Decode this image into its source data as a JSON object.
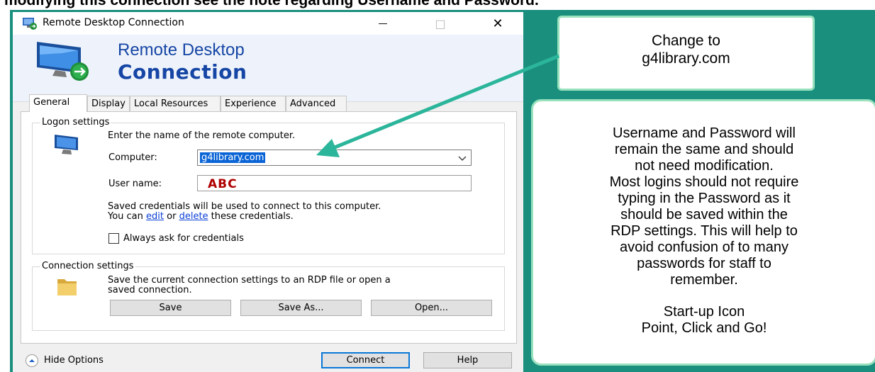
{
  "caption": "modifying this connection see the note regarding Username and Password.",
  "window": {
    "title": "Remote Desktop Connection",
    "minimize_glyph": "—",
    "maximize_glyph": "□",
    "close_glyph": "✕"
  },
  "banner": {
    "line1": "Remote Desktop",
    "line2": "Connection"
  },
  "tabs": [
    "General",
    "Display",
    "Local Resources",
    "Experience",
    "Advanced"
  ],
  "logon": {
    "legend": "Logon settings",
    "instruction": "Enter the name of the remote computer.",
    "computer_label": "Computer:",
    "computer_value": "g4library.com",
    "username_label": "User name:",
    "username_value": "ABC",
    "saved_line1": "Saved credentials will be used to connect to this computer.",
    "saved_prefix": "You can ",
    "edit_link": "edit",
    "saved_or": " or ",
    "delete_link": "delete",
    "saved_suffix": " these credentials.",
    "always_ask": "Always ask for credentials"
  },
  "connection": {
    "legend": "Connection settings",
    "description_line1": "Save the current connection settings to an RDP file or open a",
    "description_line2": "saved connection.",
    "save": "Save",
    "save_as": "Save As...",
    "open": "Open..."
  },
  "footer": {
    "hide_options": "Hide Options",
    "connect": "Connect",
    "help": "Help"
  },
  "callout_change": {
    "line1": "Change to",
    "line2": "g4library.com"
  },
  "callout_note": {
    "lines": [
      "Username and Password will",
      "remain the same and should",
      "not need modification.",
      "Most logins should not require",
      "typing in the Password as it",
      "should be saved within the",
      "RDP settings. This will help to",
      "avoid confusion of to many",
      "passwords for staff to",
      "remember."
    ],
    "closing_line1": "Start-up Icon",
    "closing_line2": "Point, Click and Go!"
  },
  "colors": {
    "teal_background": "#1a8f7e",
    "arrow": "#2bb59a",
    "callout_border": "#98e1bd",
    "banner_blue": "#1646a5",
    "selection_blue": "#0a64d6"
  }
}
